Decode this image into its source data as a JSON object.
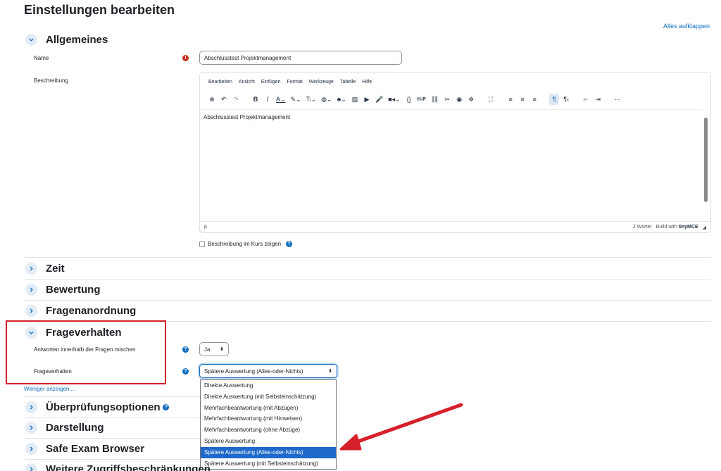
{
  "page_title": "Einstellungen bearbeiten",
  "expand_all": "Alles aufklappen",
  "sections": {
    "allgemeines": "Allgemeines",
    "zeit": "Zeit",
    "bewertung": "Bewertung",
    "fragenanordnung": "Fragenanordnung",
    "frageverhalten": "Frageverhalten",
    "ueberpruefung": "Überprüfungsoptionen",
    "darstellung": "Darstellung",
    "safe_exam": "Safe Exam Browser",
    "weitere": "Weitere Zugriffsbeschränkungen"
  },
  "general": {
    "name_label": "Name",
    "name_value": "Abschlusstest Projektmanagement",
    "description_label": "Beschreibung",
    "show_description_label": "Beschreibung im Kurs zeigen"
  },
  "editor": {
    "menu": [
      "Bearbeiten",
      "Ansicht",
      "Einfügen",
      "Format",
      "Werkzeuge",
      "Tabelle",
      "Hilfe"
    ],
    "content": "Abschlusstest Projektmanagement",
    "path": "p",
    "word_count": "2 Wörter",
    "build_with": "Build with",
    "brand": "tinyMCE"
  },
  "behaviour": {
    "shuffle_label": "Antworten innerhalb der Fragen mischen",
    "shuffle_value": "Ja",
    "behaviour_label": "Frageverhalten",
    "behaviour_value": "Spätere Auswertung (Alles-oder-Nichts)",
    "options": [
      "Direkte Auswertung",
      "Direkte Auswertung (mit Selbsteinschätzung)",
      "Mehrfachbeantwortung (mit Abzügen)",
      "Mehrfachbeantwortung (mit Hinweisen)",
      "Mehrfachbeantwortung (ohne Abzüge)",
      "Spätere Auswertung",
      "Spätere Auswertung (Alles-oder-Nichts)",
      "Spätere Auswertung (mit Selbsteinschätzung)"
    ],
    "selected_index": 6,
    "show_less": "Weniger anzeigen ..."
  },
  "colors": {
    "link": "#0f6cbf",
    "highlight": "#d6202b",
    "selected_option": "#1e69c9",
    "required": "#ca3120"
  }
}
